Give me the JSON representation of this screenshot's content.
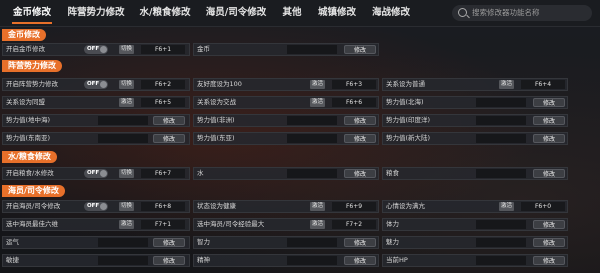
{
  "tabs": [
    "金币修改",
    "阵营势力修改",
    "水/粮食修改",
    "海员/司令修改",
    "其他",
    "城镇修改",
    "海战修改"
  ],
  "search_placeholder": "搜索修改器功能名称",
  "toggle_off": "OFF",
  "switch_label": "切换",
  "activate_label": "激活",
  "modify_label": "修改",
  "sections": {
    "gold": "金币修改",
    "faction": "阵营势力修改",
    "water": "水/粮食修改",
    "crew": "海员/司令修改"
  },
  "gold": {
    "enable": "开启金币修改",
    "enable_key": "F6+1",
    "gold": "金币"
  },
  "faction": {
    "enable": "开启阵营势力修改",
    "enable_key": "F6+2",
    "friendly100": "友好度设为100",
    "friendly100_key": "F6+3",
    "normal": "关系设为普通",
    "normal_key": "F6+4",
    "ally": "关系设为同盟",
    "ally_key": "F6+5",
    "hostile": "关系设为交战",
    "hostile_key": "F6+6",
    "north_asia": "势力值(北海)",
    "ground_sea": "势力值(地中海)",
    "africa": "势力值(非洲)",
    "caribbean": "势力值(印度洋)",
    "southeast_asia": "势力值(东南亚)",
    "east_asia": "势力值(东亚)",
    "new_continent": "势力值(新大陆)"
  },
  "water": {
    "enable": "开启粮食/水修改",
    "enable_key": "F6+7",
    "water": "水",
    "food": "粮食"
  },
  "crew": {
    "enable": "开启海员/司令修改",
    "enable_key": "F6+8",
    "healthy": "状态设为健康",
    "healthy_key": "F6+9",
    "mood": "心情设为满亢",
    "mood_key": "F6+0",
    "max6": "选中海员最佳六维",
    "max6_key": "F7+1",
    "max_exp": "选中海员/司令经验最大",
    "max_exp_key": "F7+2",
    "stamina": "体力",
    "luck": "运气",
    "wisdom": "智力",
    "charm": "魅力",
    "agility": "敏捷",
    "spirit": "精神",
    "hp": "当前HP"
  }
}
